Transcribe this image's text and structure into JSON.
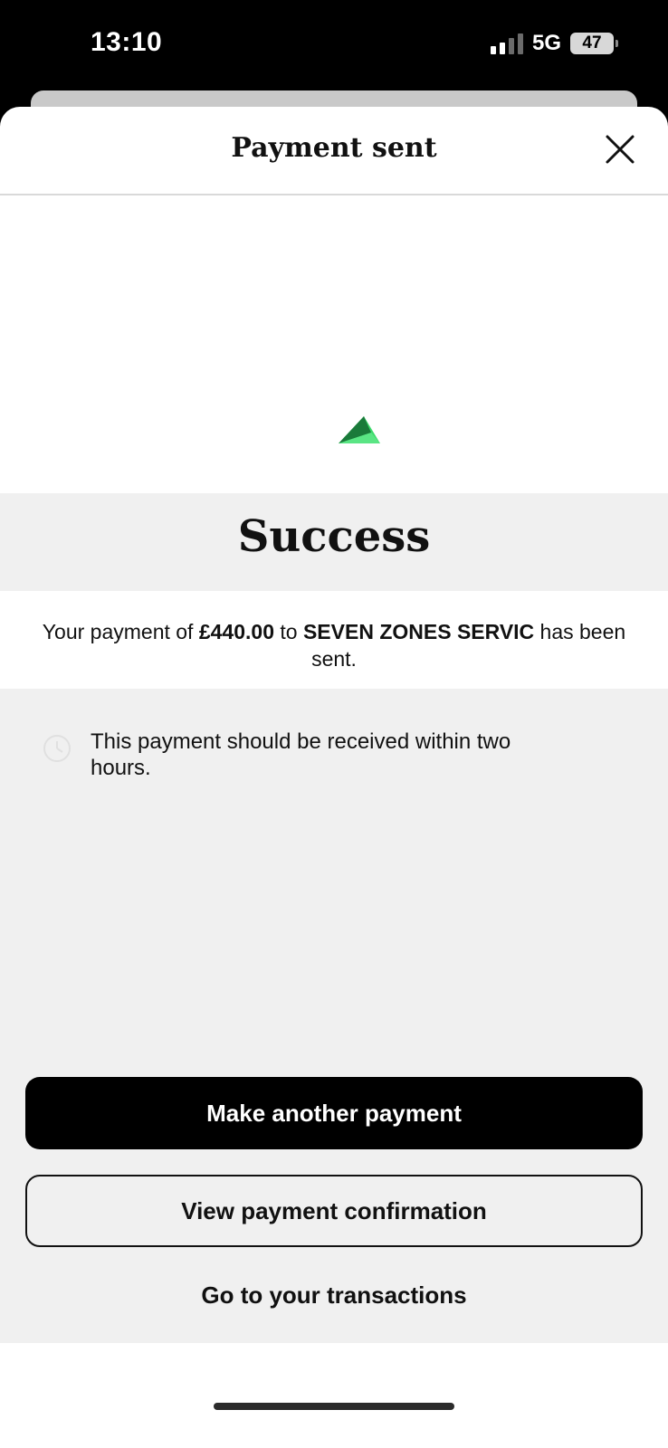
{
  "status_bar": {
    "time": "13:10",
    "network": "5G",
    "battery": "47"
  },
  "sheet": {
    "title": "Payment sent",
    "close_icon": "close-icon"
  },
  "success": {
    "title": "Success",
    "message_prefix": "Your payment of ",
    "amount": "£440.00",
    "message_mid": " to ",
    "payee": "SEVEN ZONES SERVIC",
    "message_suffix": " has been sent."
  },
  "info": {
    "icon": "clock-icon",
    "text": "This payment should be received within two hours."
  },
  "actions": {
    "primary_label": "Make another payment",
    "secondary_label": "View payment confirmation",
    "link_label": "Go to your transactions"
  },
  "colors": {
    "accent_green": "#3ddc6c",
    "accent_dark_green": "#1a7a3a",
    "background_grey": "#f0f0f0"
  }
}
